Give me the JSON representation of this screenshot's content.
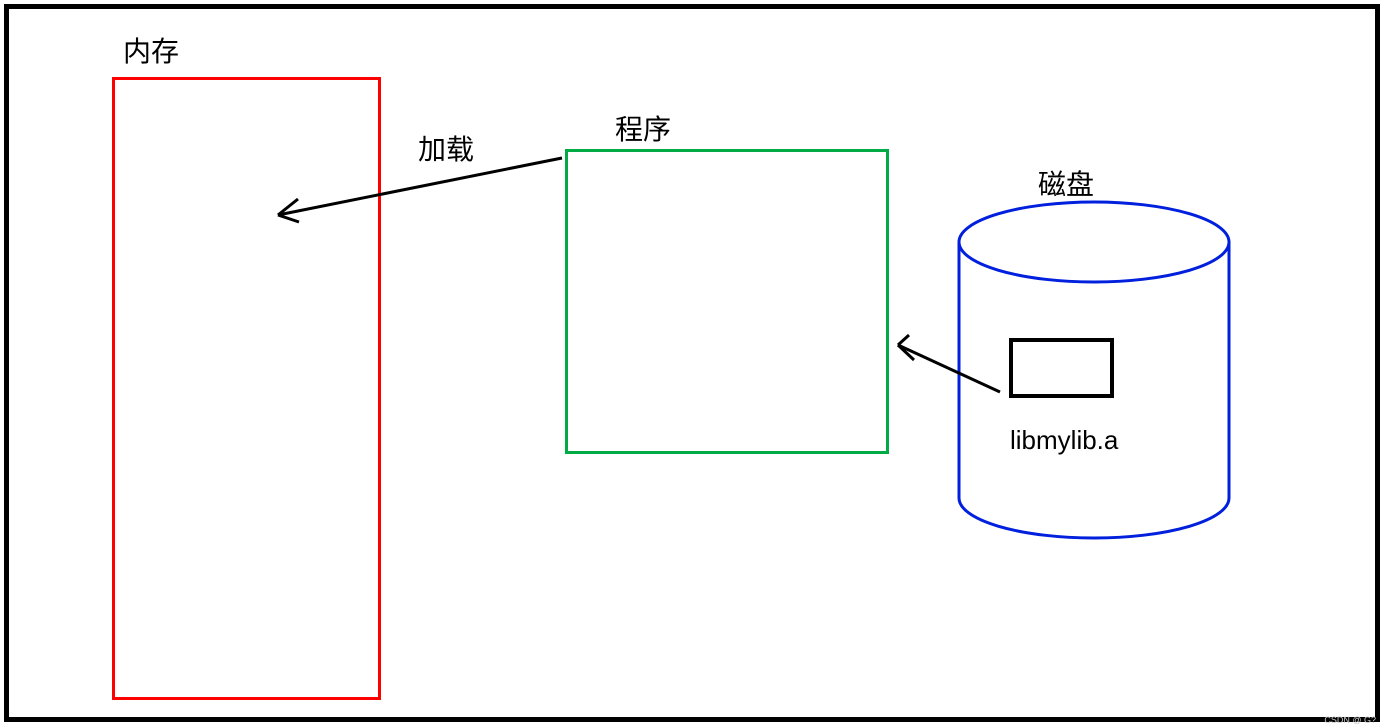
{
  "labels": {
    "memory": "内存",
    "program": "程序",
    "load": "加载",
    "disk": "磁盘",
    "lib": "libmylib.a"
  },
  "shapes": {
    "memory_box": {
      "color": "#ff0000"
    },
    "program_box": {
      "color": "#00aa44"
    },
    "disk_cylinder": {
      "color": "#0020dd"
    },
    "lib_box": {
      "color": "#000000"
    }
  },
  "arrows": [
    {
      "from": "program",
      "to": "memory",
      "label": "加载"
    },
    {
      "from": "disk_lib",
      "to": "program"
    }
  ],
  "watermark": "CSDN @ G?"
}
